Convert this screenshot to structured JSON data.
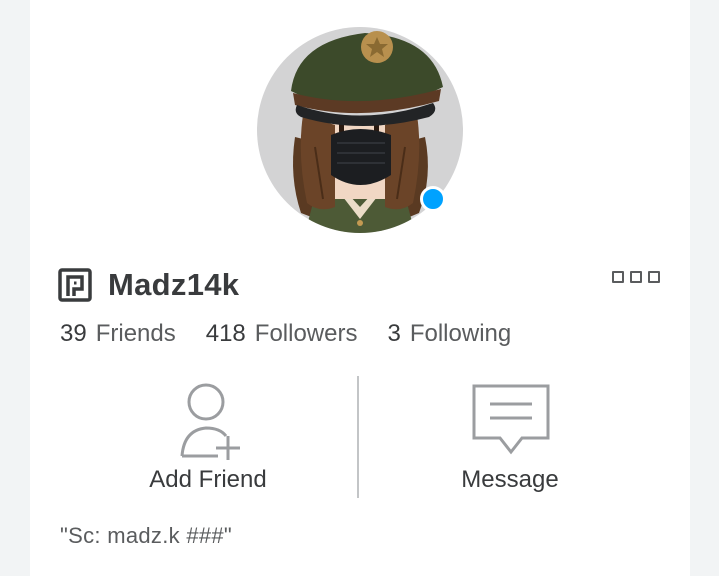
{
  "profile": {
    "username": "Madz14k",
    "status": "\"Sc: madz.k ###\"",
    "presence": "online"
  },
  "stats": {
    "friends_count": "39",
    "friends_label": "Friends",
    "followers_count": "418",
    "followers_label": "Followers",
    "following_count": "3",
    "following_label": "Following"
  },
  "actions": {
    "add_friend_label": "Add Friend",
    "message_label": "Message"
  },
  "icons": {
    "premium": "premium-icon",
    "more": "more-options-icon",
    "add_friend": "add-friend-icon",
    "message": "message-icon"
  },
  "colors": {
    "presence_online": "#00a2ff",
    "text_primary": "#393b3d",
    "text_secondary": "#5a5c5e",
    "background": "#f2f4f5",
    "card": "#ffffff"
  }
}
